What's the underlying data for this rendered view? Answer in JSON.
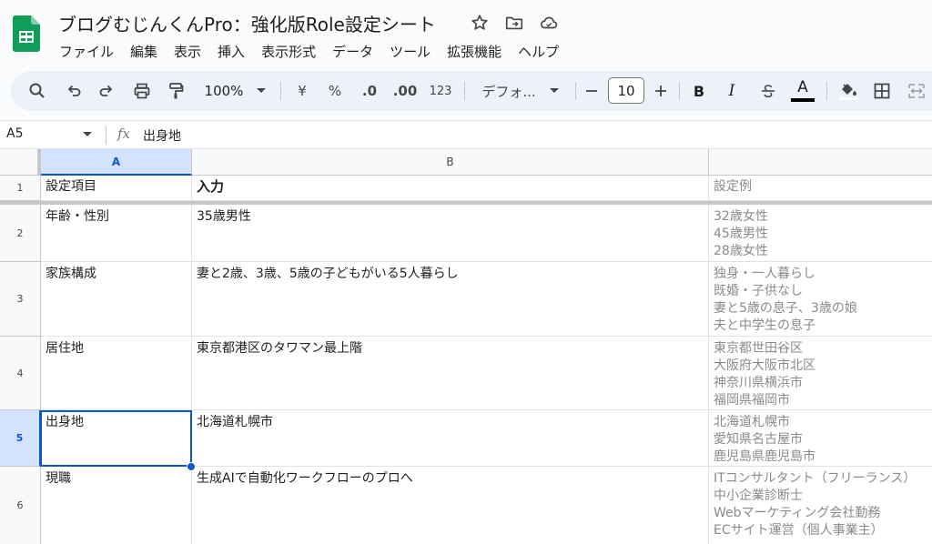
{
  "doc": {
    "title": "ブログむじんくんPro：強化版Role設定シート"
  },
  "menu": {
    "items": [
      "ファイル",
      "編集",
      "表示",
      "挿入",
      "表示形式",
      "データ",
      "ツール",
      "拡張機能",
      "ヘルプ"
    ]
  },
  "toolbar": {
    "zoom": "100%",
    "currency": "¥",
    "percent": "%",
    "decrease_decimal": ".0",
    "increase_decimal": ".00",
    "number_format": "123",
    "font": "デフォ...",
    "font_size": "10",
    "bold_label": "B",
    "italic_label": "I",
    "text_color_label": "A"
  },
  "formula_bar": {
    "cell_ref": "A5",
    "fx": "fx",
    "value": "出身地"
  },
  "columns": [
    "A",
    "B"
  ],
  "rows": [
    {
      "num": "1",
      "a": "設定項目",
      "b": "入力",
      "examples": [
        "設定例"
      ]
    },
    {
      "num": "2",
      "a": "年齢・性別",
      "b": "35歳男性",
      "examples": [
        "32歳女性",
        "45歳男性",
        "28歳女性"
      ]
    },
    {
      "num": "3",
      "a": "家族構成",
      "b": "妻と2歳、3歳、5歳の子どもがいる5人暮らし",
      "examples": [
        "独身・一人暮らし",
        "既婚・子供なし",
        "妻と5歳の息子、3歳の娘",
        "夫と中学生の息子"
      ]
    },
    {
      "num": "4",
      "a": "居住地",
      "b": "東京都港区のタワマン最上階",
      "examples": [
        "東京都世田谷区",
        "大阪府大阪市北区",
        "神奈川県横浜市",
        "福岡県福岡市"
      ]
    },
    {
      "num": "5",
      "a": "出身地",
      "b": "北海道札幌市",
      "examples": [
        "北海道札幌市",
        "愛知県名古屋市",
        "鹿児島県鹿児島市"
      ]
    },
    {
      "num": "6",
      "a": "現職",
      "b": "生成AIで自動化ワークフローのプロへ",
      "examples": [
        "ITコンサルタント（フリーランス）",
        "中小企業診断士",
        "Webマーケティング会社勤務",
        "ECサイト運営（個人事業主）"
      ]
    }
  ],
  "colors": {
    "accent": "#0b57d0",
    "sheets_green": "#0f9d58"
  }
}
